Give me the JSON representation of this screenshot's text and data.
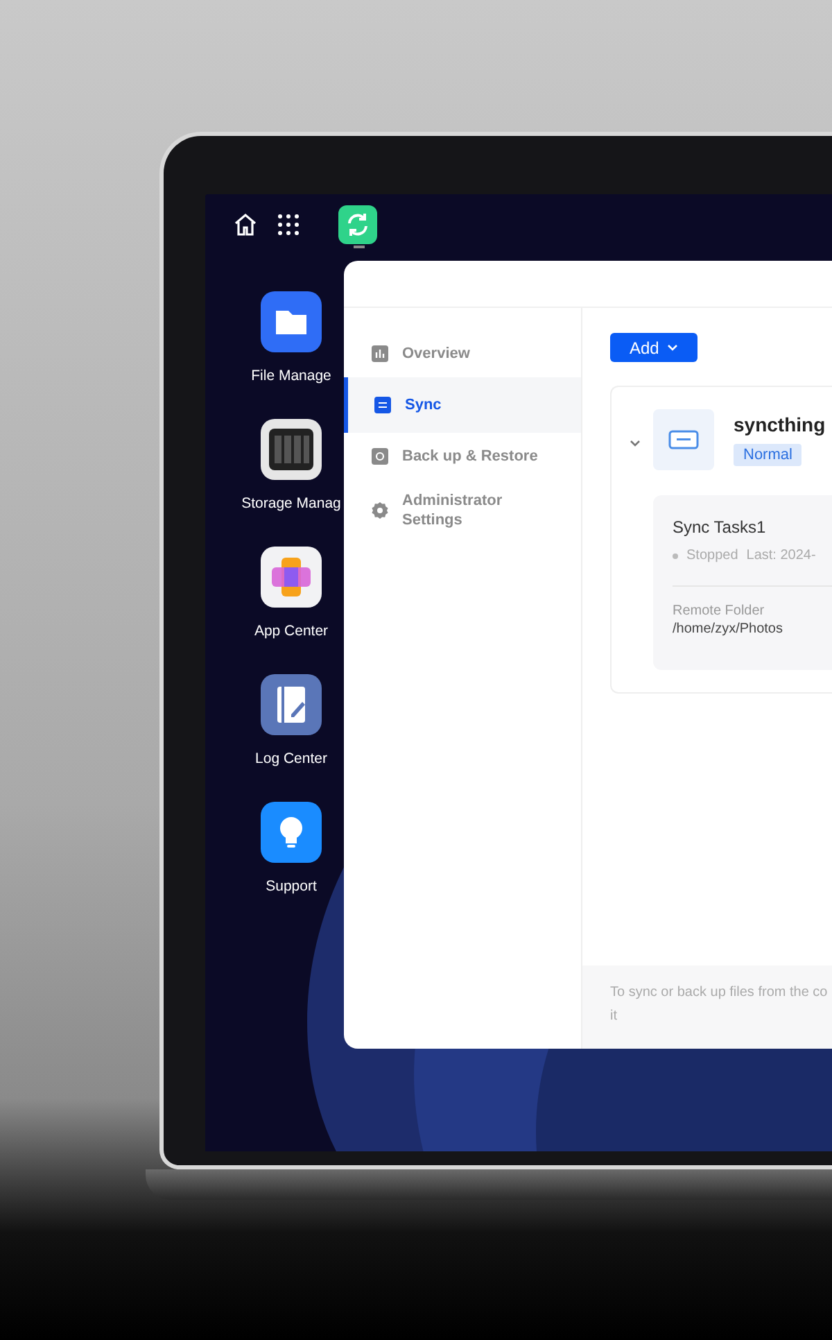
{
  "desktop_icons": [
    {
      "kind": "files",
      "label": "File Manage"
    },
    {
      "kind": "storage",
      "label": "Storage Manag"
    },
    {
      "kind": "apps",
      "label": "App Center"
    },
    {
      "kind": "logs",
      "label": "Log Center"
    },
    {
      "kind": "support",
      "label": "Support"
    }
  ],
  "window": {
    "sidebar": {
      "items": [
        {
          "kind": "overview",
          "label": "Overview",
          "selected": false
        },
        {
          "kind": "sync",
          "label": "Sync",
          "selected": true
        },
        {
          "kind": "backup",
          "label": "Back up & Restore",
          "selected": false
        },
        {
          "kind": "settings",
          "label": "Administrator Settings",
          "selected": false
        }
      ]
    },
    "add_button": "Add",
    "device": {
      "name": "syncthing",
      "status": "Normal",
      "expanded": true,
      "task": {
        "title": "Sync Tasks1",
        "state": "Stopped",
        "last": "Last: 2024-",
        "remote_label": "Remote Folder",
        "remote_path": "/home/zyx/Photos"
      }
    },
    "footer_lines": [
      "To sync or back up files from the co",
      "it"
    ]
  }
}
